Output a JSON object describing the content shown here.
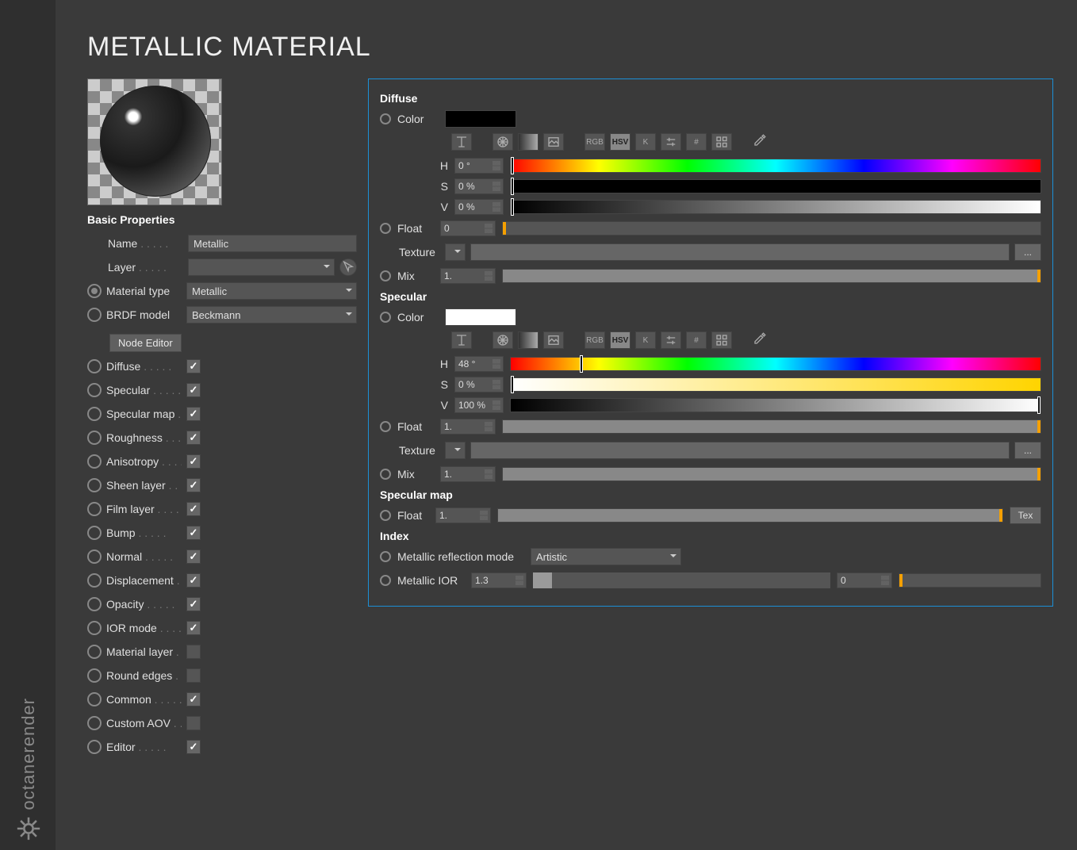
{
  "title": "METALLIC MATERIAL",
  "logo_text": "octanerender",
  "basic": {
    "section": "Basic Properties",
    "name_label": "Name",
    "name_value": "Metallic",
    "layer_label": "Layer",
    "layer_value": "",
    "material_type_label": "Material type",
    "material_type_value": "Metallic",
    "brdf_label": "BRDF model",
    "brdf_value": "Beckmann",
    "node_editor_btn": "Node Editor"
  },
  "toggles": [
    {
      "label": "Diffuse",
      "checked": true
    },
    {
      "label": "Specular",
      "checked": true
    },
    {
      "label": "Specular map",
      "checked": true
    },
    {
      "label": "Roughness",
      "checked": true
    },
    {
      "label": "Anisotropy",
      "checked": true
    },
    {
      "label": "Sheen layer",
      "checked": true
    },
    {
      "label": "Film layer",
      "checked": true
    },
    {
      "label": "Bump",
      "checked": true
    },
    {
      "label": "Normal",
      "checked": true
    },
    {
      "label": "Displacement",
      "checked": true
    },
    {
      "label": "Opacity",
      "checked": true
    },
    {
      "label": "IOR mode",
      "checked": true
    },
    {
      "label": "Material layer",
      "checked": false
    },
    {
      "label": "Round edges",
      "checked": false
    },
    {
      "label": "Common",
      "checked": true
    },
    {
      "label": "Custom AOV",
      "checked": false
    },
    {
      "label": "Editor",
      "checked": true
    }
  ],
  "picker_modes": [
    "RGB",
    "HSV",
    "K"
  ],
  "diffuse": {
    "title": "Diffuse",
    "color_label": "Color",
    "h": "0 °",
    "s": "0 %",
    "v": "0 %",
    "float_label": "Float",
    "float_val": "0",
    "texture_label": "Texture",
    "mix_label": "Mix",
    "mix_val": "1.",
    "h_marker_pct": 0,
    "s_marker_pct": 0,
    "v_marker_pct": 0
  },
  "specular": {
    "title": "Specular",
    "color_label": "Color",
    "h": "48 °",
    "s": "0 %",
    "v": "100 %",
    "float_label": "Float",
    "float_val": "1.",
    "texture_label": "Texture",
    "mix_label": "Mix",
    "mix_val": "1.",
    "h_marker_pct": 13,
    "s_marker_pct": 0,
    "v_marker_pct": 100
  },
  "specular_map": {
    "title": "Specular map",
    "float_label": "Float",
    "float_val": "1.",
    "tex_btn": "Tex"
  },
  "index": {
    "title": "Index",
    "mode_label": "Metallic reflection mode",
    "mode_value": "Artistic",
    "ior_label": "Metallic IOR",
    "ior_val": "1.3",
    "ior_second": "0"
  },
  "labels": {
    "H": "H",
    "S": "S",
    "V": "V",
    "ellipsis": "...",
    "tex": "Tex"
  }
}
